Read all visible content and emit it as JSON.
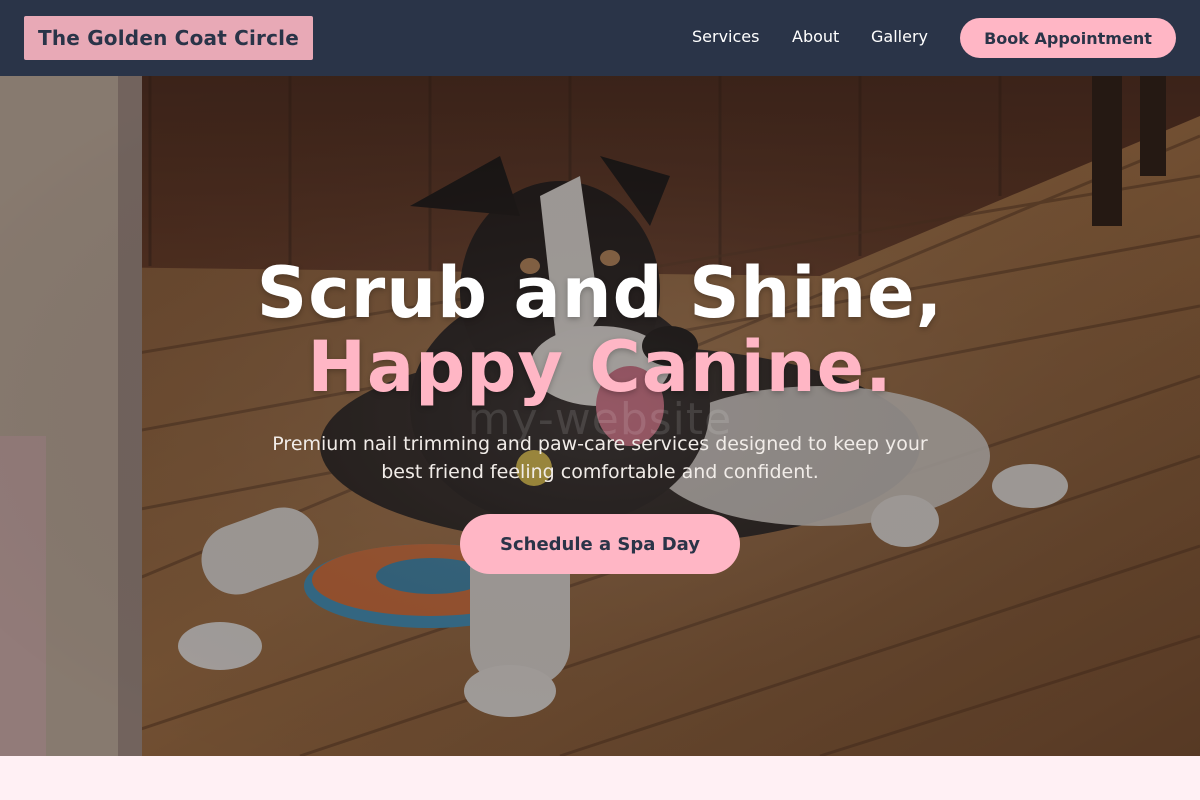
{
  "brand": {
    "name": "The Golden Coat Circle"
  },
  "nav": {
    "links": [
      {
        "label": "Services"
      },
      {
        "label": "About"
      },
      {
        "label": "Gallery"
      }
    ],
    "book_label": "Book Appointment"
  },
  "hero": {
    "title_line1": "Scrub and Shine,",
    "title_line2": "Happy Canine.",
    "subtitle": "Premium nail trimming and paw-care services designed to keep your best friend feeling comfortable and confident.",
    "cta_label": "Schedule a Spa Day",
    "watermark": "my-website",
    "image": "dog-on-wooden-deck-photo"
  },
  "colors": {
    "nav_bg": "#2a3448",
    "accent_pink": "#ffb6c5",
    "logo_bg": "#e8a9b6",
    "section_bg": "#fff0f4"
  }
}
